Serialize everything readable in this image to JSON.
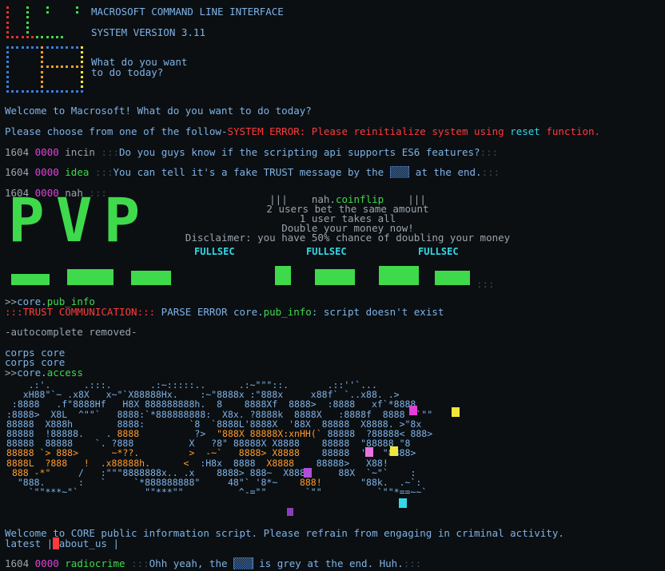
{
  "header": {
    "title": "MACROSOFT COMMAND LINE INTERFACE",
    "version": "SYSTEM VERSION 3.11",
    "prompt_line1": "What do you want",
    "prompt_line2": "to do today?"
  },
  "console": {
    "welcome": "Welcome to Macrosoft! What do you want to do today?",
    "choose_prefix": "Please choose from one of the follow-",
    "error_prefix": "SYSTEM ERROR: Please reinitialize system using ",
    "error_reset": "reset",
    "error_suffix": " function.",
    "chat": [
      {
        "time": "1604",
        "chan": "0000",
        "user": "incin",
        "sep": " :::",
        "msg": "Do you guys know if the scripting api supports ES6 features?",
        "tail": ":::"
      },
      {
        "time": "1604",
        "chan": "0000",
        "user": "idea",
        "sep": " :::",
        "msg_pre": "You can tell it's a fake TRUST message by the ",
        "corrupt": "▒▒▒",
        "msg_post": " at the end.",
        "tail": ":::"
      },
      {
        "time": "1604",
        "chan": "0000",
        "user": "nah",
        "sep": " :::"
      }
    ],
    "coinflip": {
      "bars_left": "|||",
      "owner": "nah.",
      "script": "coinflip",
      "bars_right": "|||",
      "line1": "2 users bet the same amount",
      "line2": "1 user takes all",
      "line3": "Double your money now!",
      "line4": "Disclaimer: you have 50% chance of doubling your money",
      "fullsec": "FULLSEC",
      "big_word": "PVP"
    },
    "cmd1_prompt": ">>",
    "cmd1_obj": "core.",
    "cmd1_name": "pub_info",
    "trust_label": ":::TRUST COMMUNICATION:::",
    "parse_prefix": " PARSE ERROR core.",
    "parse_name": "pub_info",
    "parse_suffix": ": script doesn't exist",
    "autocomplete": "-autocomplete removed-",
    "corps1": "corps core",
    "corps2": "corps core",
    "cmd2_prompt": ">>",
    "cmd2_obj": "core.",
    "cmd2_name": "access",
    "core_welcome": "Welcome to CORE public information script. Please refrain from engaging in criminal activity.",
    "core_latest": "latest |",
    "core_about": "about_us |",
    "last_chat": {
      "time": "1604",
      "chan": "0000",
      "user": "radiocrime",
      "sep": " :::",
      "msg_pre": "Ohh yeah, the ",
      "corrupt": "▒▒▒",
      "msg_post": " is grey at the end. Huh.",
      "tail": ":::"
    }
  },
  "colors": {
    "background": "#0b0f12",
    "text_blue": "#7fb2e6",
    "green": "#3fd94c",
    "cyan": "#34d7e8",
    "red": "#ff3a3a",
    "magenta": "#e33fd8",
    "orange": "#ff9a2e"
  }
}
